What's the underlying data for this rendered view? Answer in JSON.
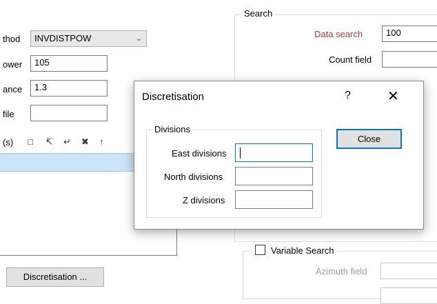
{
  "left": {
    "method_label": "thod",
    "method_value": "INVDISTPOW",
    "power_label": "ower",
    "power_value": "105",
    "tolerance_label": "ance",
    "tolerance_value": "1.3",
    "file_label": "file",
    "file_value": "",
    "toolbar_label": "(s)",
    "discretisation_button": "Discretisation ..."
  },
  "search": {
    "title": "Search",
    "data_search_label": "Data search",
    "data_search_value": "100",
    "count_field_label": "Count field",
    "count_field_value": "",
    "variable_search_label": "Variable Search",
    "azimuth_field_label": "Azimuth field"
  },
  "dialog": {
    "title": "Discretisation",
    "help": "?",
    "close_glyph": "✕",
    "divisions_title": "Divisions",
    "east_label": "East divisions",
    "east_value": "",
    "north_label": "North divisions",
    "north_value": "",
    "z_label": "Z divisions",
    "z_value": "",
    "close_button": "Close"
  },
  "colors": {
    "accent_label": "#c0392b",
    "selection": "#cce4f7",
    "focus_border": "#0078d7"
  }
}
